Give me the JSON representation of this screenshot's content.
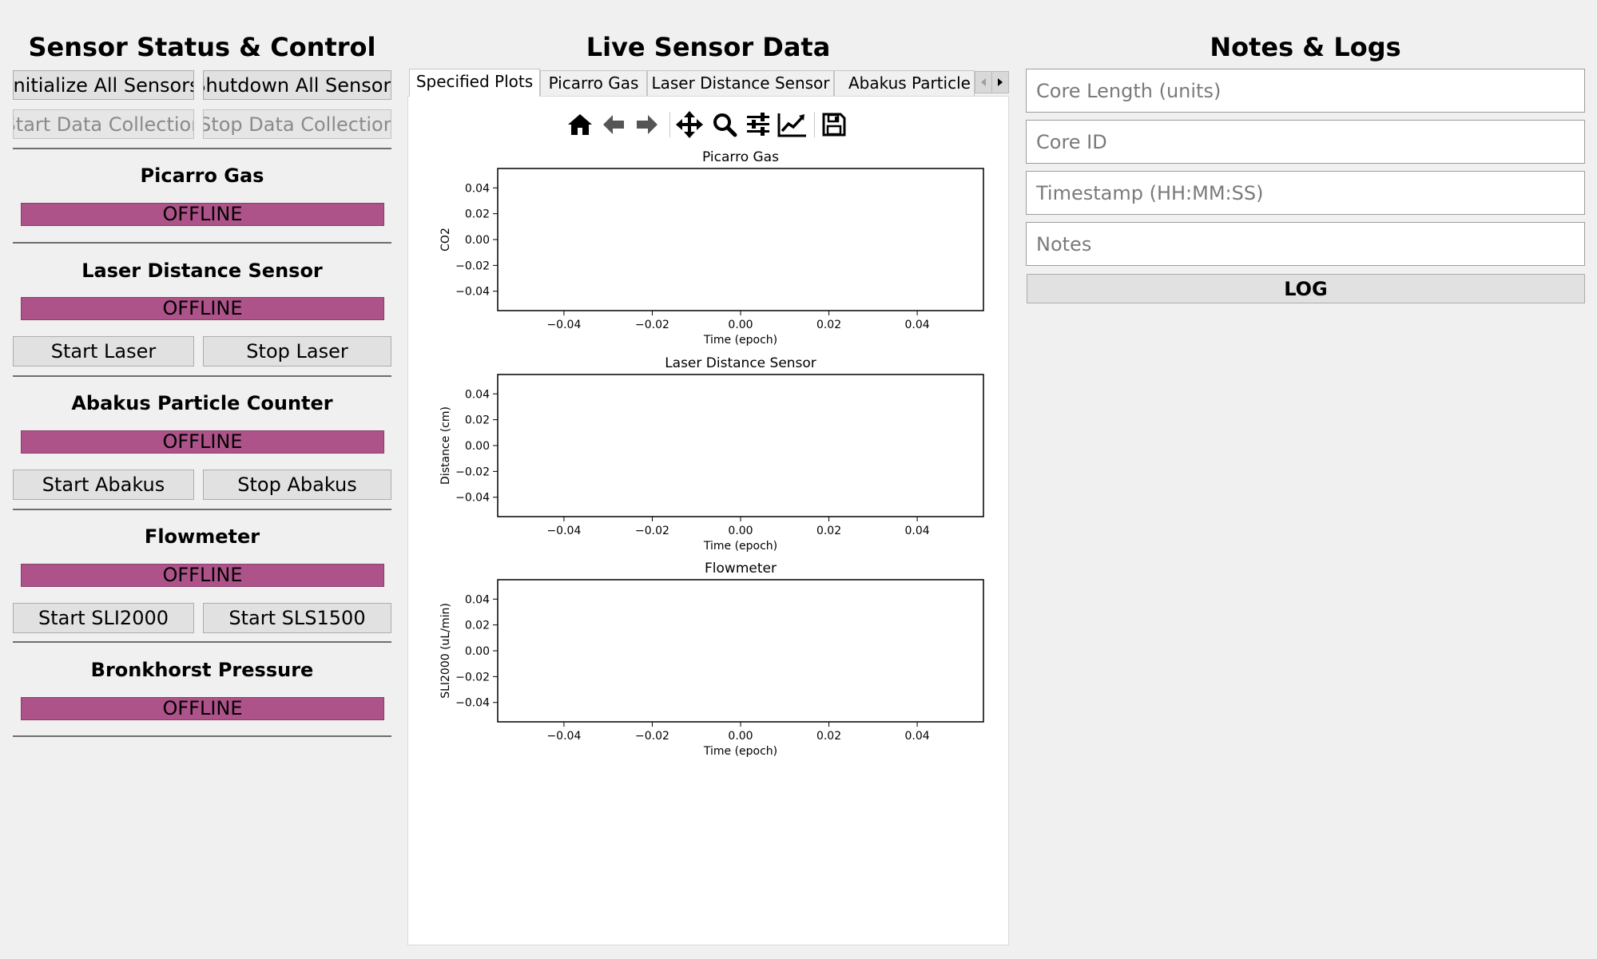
{
  "left_panel": {
    "title": "Sensor Status & Control",
    "init_all": "Initialize All Sensors",
    "shutdown_all": "Shutdown All Sensors",
    "start_collection": "Start Data Collection",
    "stop_collection": "Stop Data Collection",
    "sensors": [
      {
        "name": "Picarro Gas",
        "status": "OFFLINE"
      },
      {
        "name": "Laser Distance Sensor",
        "status": "OFFLINE",
        "start": "Start Laser",
        "stop": "Stop Laser"
      },
      {
        "name": "Abakus Particle Counter",
        "status": "OFFLINE",
        "start": "Start Abakus",
        "stop": "Stop Abakus"
      },
      {
        "name": "Flowmeter",
        "status": "OFFLINE",
        "start": "Start SLI2000",
        "stop": "Start SLS1500"
      },
      {
        "name": "Bronkhorst Pressure",
        "status": "OFFLINE"
      }
    ],
    "status_color": "#ad5389"
  },
  "center_panel": {
    "title": "Live Sensor Data",
    "tabs": [
      "Specified Plots",
      "Picarro Gas",
      "Laser Distance Sensor",
      "Abakus Particle Co"
    ],
    "toolbar": [
      "home-icon",
      "back-arrow-icon",
      "forward-arrow-icon",
      "pan-icon",
      "zoom-icon",
      "configure-subplots-icon",
      "edit-axis-icon",
      "save-icon"
    ]
  },
  "chart_data": [
    {
      "type": "line",
      "title": "Picarro Gas",
      "xlabel": "Time (epoch)",
      "ylabel": "CO2",
      "x": [],
      "y": [],
      "xlim": [
        -0.055,
        0.055
      ],
      "ylim": [
        -0.055,
        0.055
      ],
      "xticks": [
        "−0.04",
        "−0.02",
        "0.00",
        "0.02",
        "0.04"
      ],
      "yticks": [
        "0.04",
        "0.02",
        "0.00",
        "−0.02",
        "−0.04"
      ]
    },
    {
      "type": "line",
      "title": "Laser Distance Sensor",
      "xlabel": "Time (epoch)",
      "ylabel": "Distance (cm)",
      "x": [],
      "y": [],
      "xlim": [
        -0.055,
        0.055
      ],
      "ylim": [
        -0.055,
        0.055
      ],
      "xticks": [
        "−0.04",
        "−0.02",
        "0.00",
        "0.02",
        "0.04"
      ],
      "yticks": [
        "0.04",
        "0.02",
        "0.00",
        "−0.02",
        "−0.04"
      ]
    },
    {
      "type": "line",
      "title": "Flowmeter",
      "xlabel": "Time (epoch)",
      "ylabel": "SLI2000 (uL/min)",
      "x": [],
      "y": [],
      "xlim": [
        -0.055,
        0.055
      ],
      "ylim": [
        -0.055,
        0.055
      ],
      "xticks": [
        "−0.04",
        "−0.02",
        "0.00",
        "0.02",
        "0.04"
      ],
      "yticks": [
        "0.04",
        "0.02",
        "0.00",
        "−0.02",
        "−0.04"
      ]
    }
  ],
  "right_panel": {
    "title": "Notes & Logs",
    "core_length_placeholder": "Core Length (units)",
    "core_id_placeholder": "Core ID",
    "timestamp_placeholder": "Timestamp (HH:MM:SS)",
    "notes_placeholder": "Notes",
    "log_button": "LOG"
  }
}
